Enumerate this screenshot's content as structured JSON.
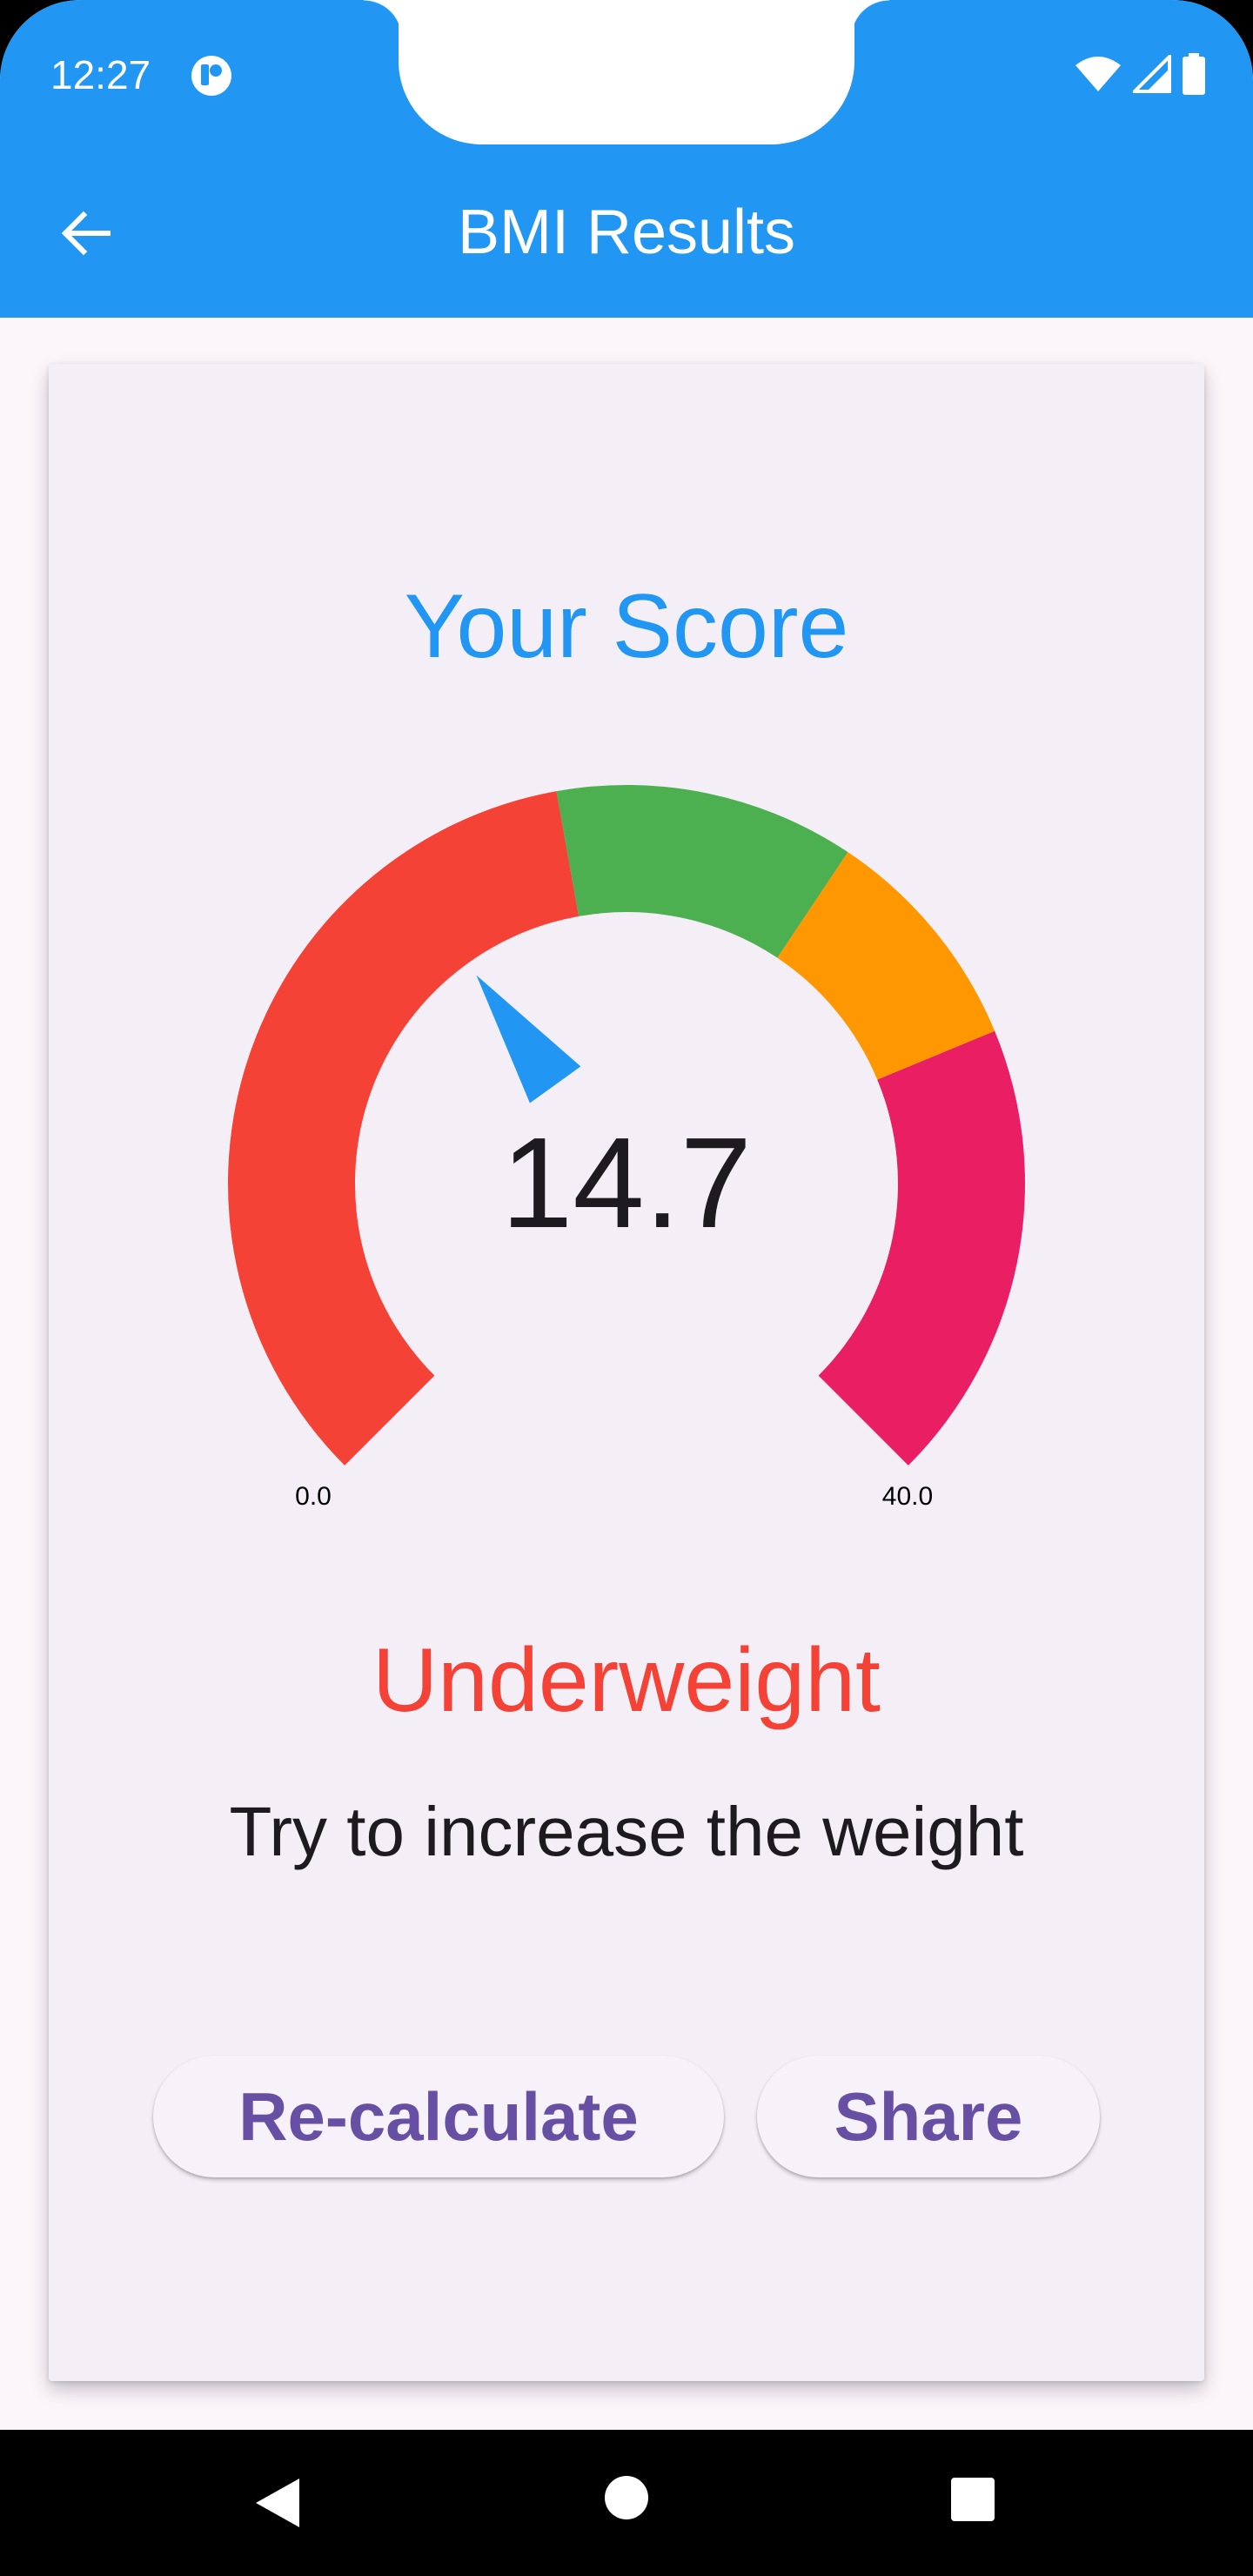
{
  "status_bar": {
    "time": "12:27",
    "icons": [
      "app-notification-icon",
      "wifi-icon",
      "signal-icon",
      "battery-icon"
    ]
  },
  "app_bar": {
    "title": "BMI Results",
    "back_icon": "arrow-back-icon",
    "color": "#2196f3"
  },
  "card": {
    "heading": "Your Score",
    "gauge": {
      "value": 14.7,
      "value_label": "14.7",
      "min_label": "0.0",
      "max_label": "40.0",
      "min": 0,
      "max": 40,
      "segments": [
        {
          "from": 0,
          "to": 18.5,
          "color": "#f44336"
        },
        {
          "from": 18.5,
          "to": 25,
          "color": "#4caf50"
        },
        {
          "from": 25,
          "to": 30,
          "color": "#ff9800"
        },
        {
          "from": 30,
          "to": 40,
          "color": "#e91e63"
        }
      ],
      "needle_color": "#2196f3"
    },
    "category": "Underweight",
    "category_color": "#f44336",
    "advice": "Try to increase the weight",
    "buttons": {
      "recalculate": "Re-calculate",
      "share": "Share"
    }
  },
  "nav_bar": {
    "icons": [
      "nav-back-icon",
      "nav-home-icon",
      "nav-recents-icon"
    ]
  }
}
